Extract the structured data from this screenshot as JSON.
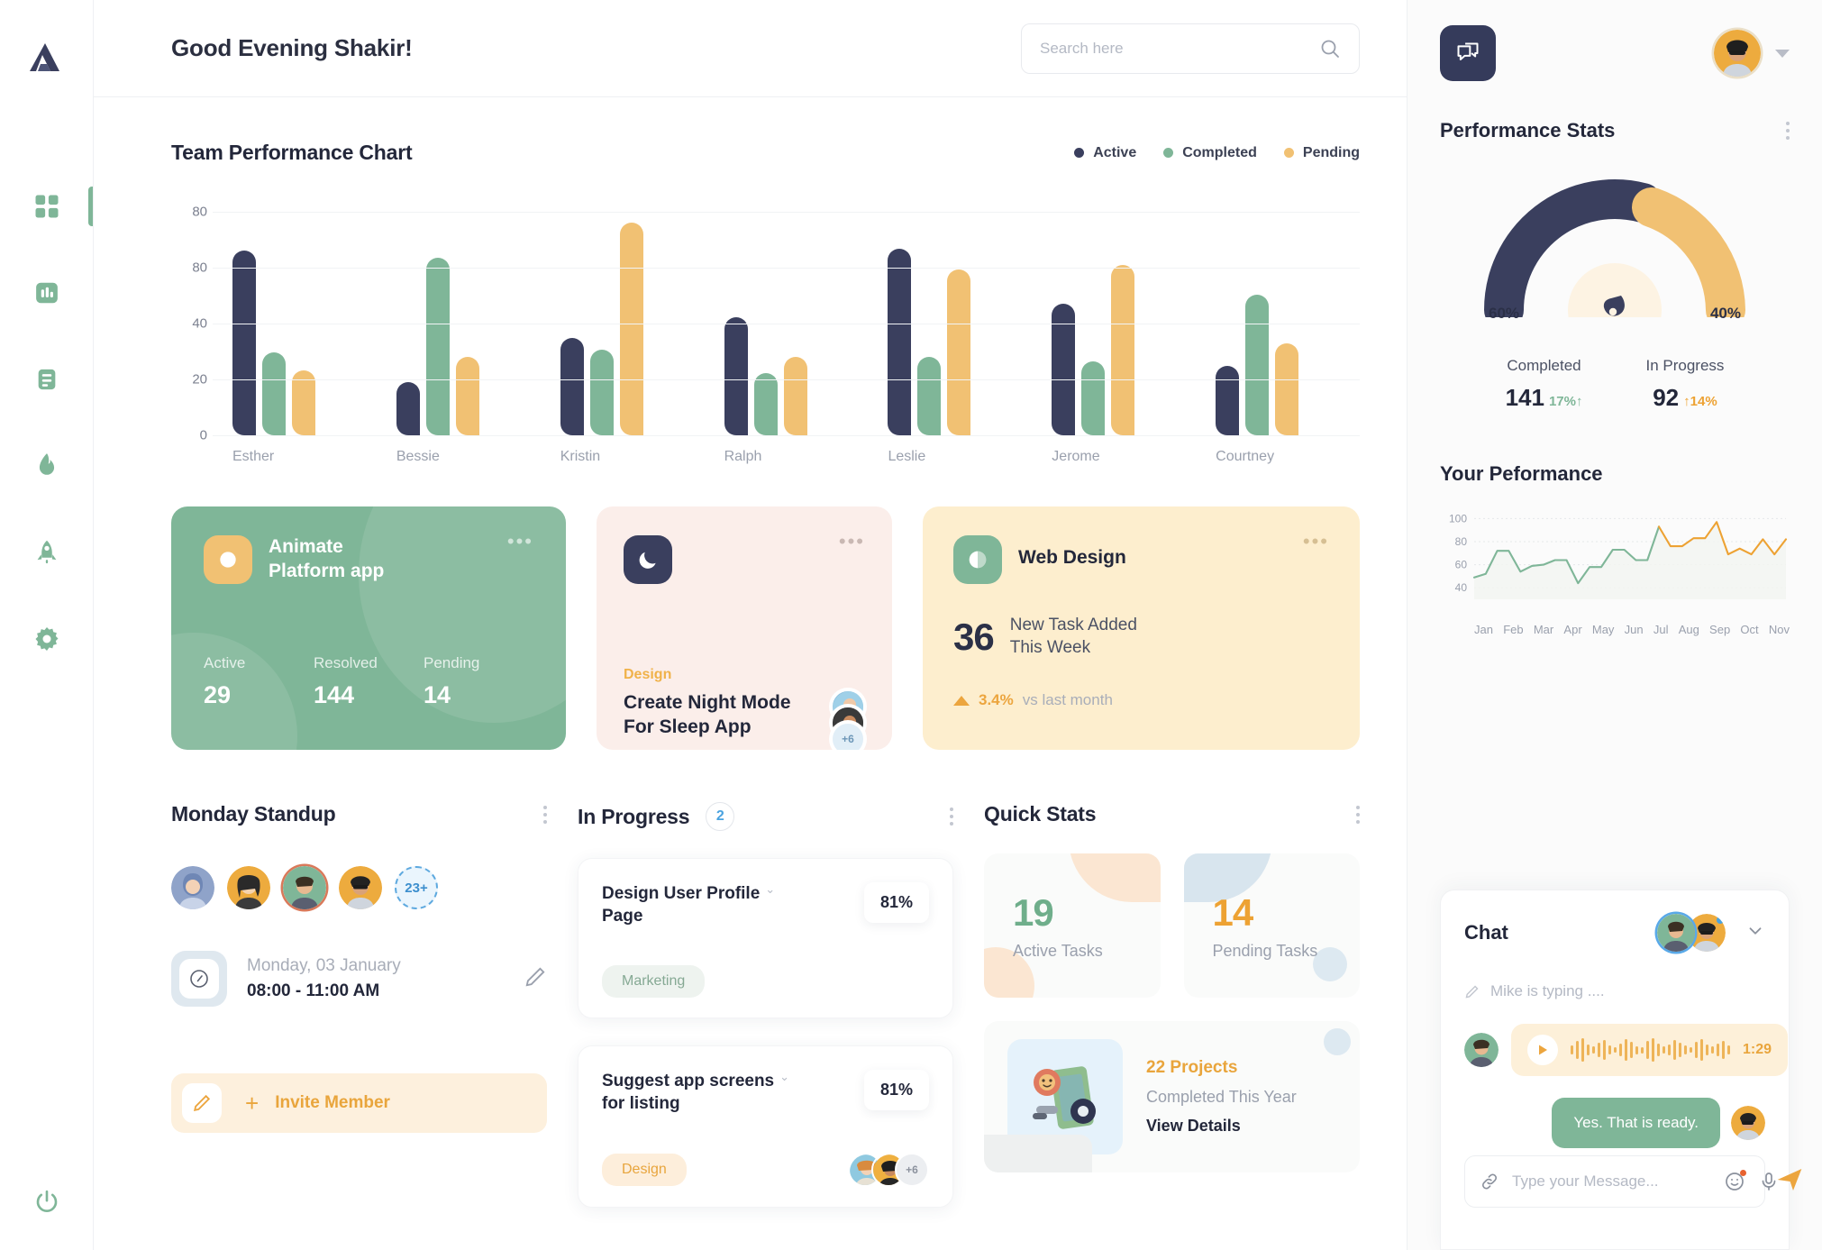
{
  "app": {
    "logo_icon": "triangle-logo-icon"
  },
  "sidebar": {
    "items": [
      {
        "icon": "grid-dashboard-icon",
        "active": true
      },
      {
        "icon": "bar-chart-icon",
        "active": false
      },
      {
        "icon": "document-icon",
        "active": false
      },
      {
        "icon": "flame-icon",
        "active": false
      },
      {
        "icon": "rocket-icon",
        "active": false
      },
      {
        "icon": "gear-icon",
        "active": false
      }
    ],
    "power_icon": "power-icon"
  },
  "topbar": {
    "greeting": "Good Evening Shakir!",
    "search": {
      "placeholder": "Search here",
      "value": "",
      "icon": "search-icon"
    }
  },
  "chart_data": {
    "type": "bar",
    "title": "Team Performance Chart",
    "categories": [
      "Esther",
      "Bessie",
      "Kristin",
      "Ralph",
      "Leslie",
      "Jerome",
      "Courtney"
    ],
    "series": [
      {
        "name": "Active",
        "color": "#3a3f5e",
        "values": [
          80,
          23,
          42,
          51,
          81,
          57,
          30
        ]
      },
      {
        "name": "Completed",
        "color": "#7fb698",
        "values": [
          36,
          77,
          37,
          27,
          34,
          32,
          61
        ]
      },
      {
        "name": "Pending",
        "color": "#f1c173",
        "values": [
          28,
          34,
          92,
          34,
          72,
          74,
          40
        ]
      }
    ],
    "xlabel": "",
    "ylabel": "",
    "yticks": [
      "80",
      "80",
      "40",
      "20",
      "0"
    ],
    "ylim": [
      0,
      100
    ],
    "grid": true,
    "legend_position": "top-right"
  },
  "promos": [
    {
      "icon": "circle-badge-icon",
      "title": "Animate\nPlatform app",
      "menu_icon": "more-horizontal-icon",
      "stats": [
        {
          "label": "Active",
          "value": "29"
        },
        {
          "label": "Resolved",
          "value": "144"
        },
        {
          "label": "Pending",
          "value": "14"
        }
      ]
    },
    {
      "icon": "moon-icon",
      "menu_icon": "more-horizontal-icon",
      "tag": "Design",
      "title": "Create Night Mode\nFor Sleep App",
      "avatars_more": "+6"
    },
    {
      "icon": "contrast-circle-icon",
      "title": "Web Design",
      "menu_icon": "more-horizontal-icon",
      "number": "36",
      "subtitle": "New Task Added\nThis Week",
      "delta_icon": "triangle-up-icon",
      "delta_value": "3.4%",
      "delta_label": "vs last month"
    }
  ],
  "standup": {
    "title": "Monday Standup",
    "menu_icon": "kebab-menu-icon",
    "members_more": "23+",
    "schedule_icon": "clock-icon",
    "date": "Monday, 03 January",
    "time": "08:00 - 11:00 AM",
    "edit_icon": "pencil-icon",
    "invite_icon": "pen-icon",
    "invite_plus": "+",
    "invite_label": "Invite Member"
  },
  "in_progress": {
    "title": "In Progress",
    "count": "2",
    "menu_icon": "kebab-menu-icon",
    "tasks": [
      {
        "title": "Design User Profile\nPage",
        "chevron_icon": "chevron-down-icon",
        "percent": "81%",
        "tag": "Marketing",
        "tag_style": "marketing",
        "avatars_more": ""
      },
      {
        "title": "Suggest app screens\nfor listing",
        "chevron_icon": "chevron-down-icon",
        "percent": "81%",
        "tag": "Design",
        "tag_style": "design",
        "avatars_more": "+6"
      }
    ]
  },
  "quick_stats": {
    "title": "Quick Stats",
    "menu_icon": "kebab-menu-icon",
    "cards": [
      {
        "value": "19",
        "label": "Active Tasks",
        "color": "#6fae8b"
      },
      {
        "value": "14",
        "label": "Pending Tasks",
        "color": "#eda233"
      }
    ],
    "projects": {
      "illustration_icon": "projects-illustration-icon",
      "title": "22 Projects",
      "subtitle": "Completed This Year",
      "link": "View Details"
    }
  },
  "right_panel": {
    "chat_button_icon": "chat-windows-icon",
    "profile_avatar_icon": "user-avatar",
    "profile_caret_icon": "caret-down-icon",
    "performance_stats": {
      "title": "Performance Stats",
      "menu_icon": "kebab-menu-icon",
      "gauge": {
        "center_icon": "droplet-icon",
        "left_percent": "60%",
        "right_percent": "40%",
        "completed_color": "#3a3f5e",
        "inprogress_color": "#f1c173"
      },
      "legend": [
        {
          "label": "Completed",
          "value": "141",
          "delta": "17%↑",
          "delta_color": "#7fb698"
        },
        {
          "label": "In Progress",
          "value": "92",
          "delta": "↑14%",
          "delta_color": "#eda233"
        }
      ]
    },
    "your_performance": {
      "title": "Your Peformance",
      "chart_data": {
        "type": "line",
        "title": "Your Peformance",
        "yticks": [
          "100",
          "80",
          "60",
          "40"
        ],
        "ylim": [
          30,
          105
        ],
        "xlabel": "",
        "ylabel": "",
        "grid": true,
        "x": [
          "Jan",
          "Feb",
          "Mar",
          "Apr",
          "May",
          "Jun",
          "Jul",
          "Aug",
          "Sep",
          "Oct",
          "Nov"
        ],
        "series": [
          {
            "name": "Performance",
            "color_start": "#7fb698",
            "color_end": "#eda233",
            "values": [
              49,
              52,
              72,
              72,
              54,
              59,
              60,
              64,
              64,
              44,
              58,
              58,
              73,
              73,
              64,
              64,
              93,
              76,
              76,
              83,
              83,
              97,
              69,
              74,
              69,
              82,
              69,
              82
            ]
          }
        ]
      }
    },
    "chat": {
      "title": "Chat",
      "collapse_icon": "chevron-down-icon",
      "typing_icon": "pencil-icon",
      "typing_text": "Mike is typing ....",
      "voice_message": {
        "play_icon": "play-icon",
        "duration": "1:29"
      },
      "messages": [
        {
          "from": "me",
          "text": "Yes. That is ready."
        }
      ],
      "composer": {
        "attach_icon": "link-icon",
        "placeholder": "Type your Message...",
        "value": "",
        "emoji_icon": "smiley-icon",
        "mic_icon": "microphone-icon",
        "send_icon": "send-icon"
      }
    }
  }
}
